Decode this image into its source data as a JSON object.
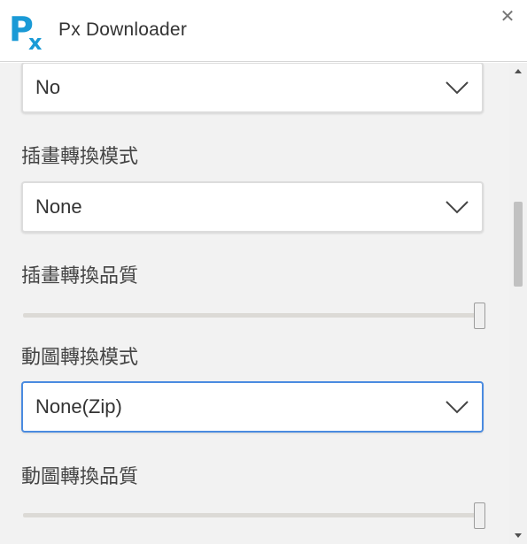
{
  "app": {
    "title": "Px Downloader",
    "logo_letter": "P",
    "logo_sub": "x",
    "close_glyph": "✕",
    "accent_color": "#1a9ad6"
  },
  "settings": {
    "top_select": {
      "value": "No"
    },
    "illust_mode": {
      "label": "插畫轉換模式",
      "value": "None"
    },
    "illust_quality": {
      "label": "插畫轉換品質",
      "level": 1.0
    },
    "ugoira_mode": {
      "label": "動圖轉換模式",
      "value": "None(Zip)"
    },
    "ugoira_quality": {
      "label": "動圖轉換品質",
      "level": 1.0
    }
  },
  "icons": {
    "dropdown": "chevron-down-icon",
    "close": "close-icon",
    "scroll_up": "scroll-up-arrow-icon",
    "scroll_down": "scroll-down-arrow-icon"
  },
  "colors": {
    "focus_border": "#4a8be0",
    "background": "#f2f2f2"
  }
}
